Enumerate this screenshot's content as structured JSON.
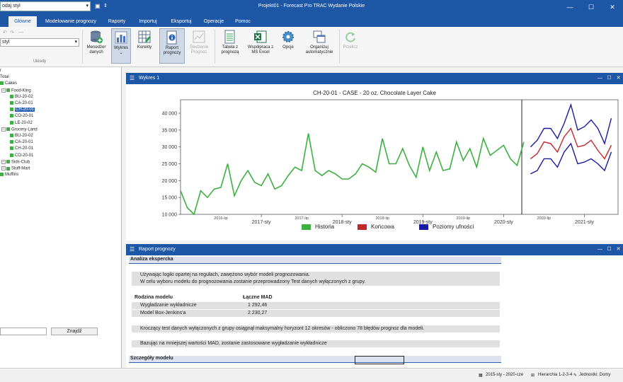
{
  "window": {
    "style_combo": "odaj styl",
    "title": "Projekt01 - Forecast Pro TRAC Wydanie Polskie"
  },
  "tabs": [
    "Główne",
    "Modelowanie prognozy",
    "Raporty",
    "Importuj",
    "Eksportuj",
    "Operacje",
    "Pomoc"
  ],
  "ribbon": {
    "layout_combo": "styl",
    "group_label": "Układy",
    "buttons": [
      {
        "label": "Menedżer danych",
        "icon": "database-icon"
      },
      {
        "label": "Wykres",
        "icon": "bar-chart-icon"
      },
      {
        "label": "Korekty",
        "icon": "grid-icon"
      },
      {
        "label": "Tabele",
        "icon": "table-icon"
      },
      {
        "label": "Raport prognozy",
        "icon": "report-icon"
      },
      {
        "label": "Śledzenie Prognoz",
        "icon": "tracking-icon"
      },
      {
        "label": "Tabela z prognozą",
        "icon": "forecast-table-icon"
      },
      {
        "label": "Współpraca z MS Excel",
        "icon": "excel-icon"
      },
      {
        "label": "Opcje",
        "icon": "gear-icon"
      },
      {
        "label": "Organizuj automatycznie",
        "icon": "windows-icon"
      },
      {
        "label": "Przelicz",
        "icon": "refresh-icon"
      }
    ]
  },
  "tree": {
    "items": [
      {
        "label": "r",
        "indent": 0,
        "kind": "text"
      },
      {
        "label": "Total",
        "indent": 0,
        "kind": "text"
      },
      {
        "label": "Cakes",
        "indent": 1,
        "kind": "node"
      },
      {
        "label": "Food-King",
        "indent": 2,
        "kind": "node"
      },
      {
        "label": "BU-20-02",
        "indent": 3,
        "kind": "leaf"
      },
      {
        "label": "CA-20-01",
        "indent": 3,
        "kind": "leaf"
      },
      {
        "label": "CH-20-01",
        "indent": 3,
        "kind": "leaf",
        "selected": true
      },
      {
        "label": "CO-20-01",
        "indent": 3,
        "kind": "leaf"
      },
      {
        "label": "LE-20-02",
        "indent": 3,
        "kind": "leaf"
      },
      {
        "label": "Grocery-Land",
        "indent": 2,
        "kind": "node"
      },
      {
        "label": "BU-20-02",
        "indent": 3,
        "kind": "leaf"
      },
      {
        "label": "CA-20-01",
        "indent": 3,
        "kind": "leaf"
      },
      {
        "label": "CH-20-01",
        "indent": 3,
        "kind": "leaf"
      },
      {
        "label": "CO-20-01",
        "indent": 3,
        "kind": "leaf"
      },
      {
        "label": "Sids-Club",
        "indent": 2,
        "kind": "node"
      },
      {
        "label": "Stuff-Mart",
        "indent": 2,
        "kind": "node"
      },
      {
        "label": "Muffins",
        "indent": 1,
        "kind": "node"
      }
    ],
    "find_label": "Znajdź"
  },
  "chart_panel": {
    "title": "Wykres 1"
  },
  "chart_data": {
    "type": "line",
    "title": "CH-20-01 - CASE - 20 oz. Chocolate Layer Cake",
    "ylim": [
      10000,
      44000
    ],
    "yticks": [
      "10 000",
      "15 000",
      "20 000",
      "25 000",
      "30 000",
      "35 000",
      "40 000"
    ],
    "ytick_values": [
      10000,
      15000,
      20000,
      25000,
      30000,
      35000,
      40000
    ],
    "xticks_small": [
      "2016-lip",
      "2017-lip",
      "2018-lip",
      "2019-lip",
      "2020-lip"
    ],
    "xticks_major": [
      "2017-sty",
      "2018-sty",
      "2019-sty",
      "2020-sty",
      "2021-sty"
    ],
    "series": [
      {
        "name": "Historia",
        "color": "#3cb043",
        "start": "2016-01",
        "values": [
          17000,
          12000,
          10000,
          17000,
          15000,
          17500,
          18000,
          25000,
          15500,
          20000,
          23000,
          19500,
          18500,
          22000,
          17500,
          18500,
          21500,
          24000,
          23000,
          34000,
          23000,
          21500,
          23000,
          22000,
          20500,
          20500,
          22000,
          25000,
          24000,
          22500,
          32500,
          25000,
          25000,
          29500,
          24500,
          21000,
          30000,
          23000,
          28500,
          23000,
          23500,
          31500,
          26000,
          29500,
          24000,
          32500,
          27500,
          29000,
          30500,
          26500,
          24500,
          31500
        ]
      },
      {
        "name": "Końcowa",
        "color": "#c0282d",
        "start": "2020-05",
        "values": [
          26500,
          28000,
          31500,
          31000,
          28500,
          33000,
          35500,
          30000,
          30500,
          32000,
          29000,
          26500,
          30500
        ]
      },
      {
        "name": "Poziomy ufności",
        "color": "#1a1a9e",
        "start": "2020-05",
        "upper": [
          30000,
          32000,
          35500,
          35500,
          32500,
          37000,
          42500,
          35000,
          36000,
          38000,
          35500,
          31000,
          38500
        ],
        "lower": [
          22000,
          23000,
          26500,
          26500,
          24000,
          28500,
          31000,
          25000,
          25500,
          26500,
          25000,
          23000,
          28500
        ]
      }
    ]
  },
  "report_panel": {
    "title": "Raport prognozy",
    "heading": "Analiza ekspercka",
    "line1": "Używając logiki opartej na regułach, zawężono wybór modeli prognozowania.",
    "line2": "W celu wyboru modelu do prognozowania zostanie przeprowadzony Test danych wyłączonych z grupy.",
    "col1": "Rodzina modelu",
    "col2": "Łączne MAD",
    "rows": [
      {
        "model": "Wygładzanie wykładnicze",
        "mad": "1 292,46"
      },
      {
        "model": "Model Box-Jenkins'a",
        "mad": "2 230,27"
      }
    ],
    "line3": "Kroczący test danych wyłączonych z grupy osiągnął maksymalny horyzont 12 okresów - obliczono 78 błędów prognoz dla modeli.",
    "line4": "Bazując na mniejszej wartości MAD, zostanie zastosowane wygładzanie wykładnicze",
    "details": "Szczegóły modelu"
  },
  "status": {
    "range": "2015-sty - 2020-cze",
    "hierarchy": "Hierarchia 1-2-3-4",
    "units": "Jednostki: Domy"
  },
  "colors": {
    "accent": "#1e57a6",
    "history": "#3cb043",
    "final": "#c0282d",
    "confidence": "#1a1a9e"
  }
}
